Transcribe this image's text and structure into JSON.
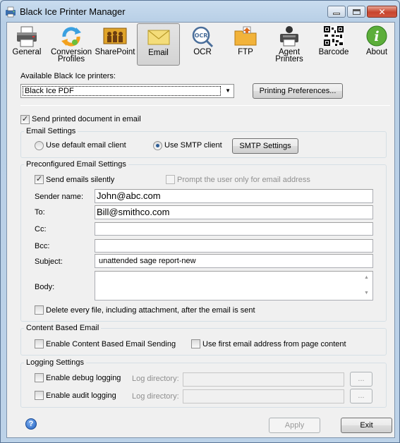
{
  "window": {
    "title": "Black Ice Printer Manager"
  },
  "toolbar": {
    "items": [
      {
        "label": "General",
        "label2": "",
        "icon": "printer-icon",
        "selected": false
      },
      {
        "label": "Conversion",
        "label2": "Profiles",
        "icon": "conversion-arrows-icon",
        "selected": false
      },
      {
        "label": "SharePoint",
        "label2": "",
        "icon": "sharepoint-people-icon",
        "selected": false
      },
      {
        "label": "Email",
        "label2": "",
        "icon": "envelope-icon",
        "selected": true
      },
      {
        "label": "OCR",
        "label2": "",
        "icon": "ocr-icon",
        "selected": false
      },
      {
        "label": "FTP",
        "label2": "",
        "icon": "ftp-folder-icon",
        "selected": false
      },
      {
        "label": "Agent",
        "label2": "Printers",
        "icon": "agent-printer-icon",
        "selected": false
      },
      {
        "label": "Barcode",
        "label2": "",
        "icon": "qr-code-icon",
        "selected": false
      },
      {
        "label": "About",
        "label2": "",
        "icon": "info-icon",
        "selected": false
      }
    ]
  },
  "printers": {
    "label": "Available Black Ice printers:",
    "selected": "Black Ice PDF",
    "preferences_button": "Printing Preferences..."
  },
  "send_email": {
    "label": "Send printed document in email",
    "checked": true
  },
  "email_settings": {
    "title": "Email Settings",
    "default_client_label": "Use default email client",
    "smtp_client_label": "Use SMTP client",
    "selected": "smtp",
    "smtp_button": "SMTP Settings"
  },
  "preconfigured": {
    "title": "Preconfigured Email Settings",
    "send_silently_label": "Send emails silently",
    "send_silently_checked": true,
    "prompt_label": "Prompt the user only for email address",
    "prompt_checked": false,
    "sender_label": "Sender name:",
    "sender_value": "John@abc.com",
    "to_label": "To:",
    "to_value": "Bill@smithco.com",
    "cc_label": "Cc:",
    "cc_value": "",
    "bcc_label": "Bcc:",
    "bcc_value": "",
    "subject_label": "Subject:",
    "subject_value": "unattended sage report-new",
    "body_label": "Body:",
    "body_value": "",
    "delete_label": "Delete every file, including attachment, after the email is sent",
    "delete_checked": false
  },
  "content_based": {
    "title": "Content Based Email",
    "enable_label": "Enable Content Based Email Sending",
    "enable_checked": false,
    "first_address_label": "Use first email address from page content",
    "first_address_checked": false
  },
  "logging": {
    "title": "Logging Settings",
    "debug_label": "Enable debug logging",
    "audit_label": "Enable audit logging",
    "log_dir_label": "Log directory:",
    "browse_label": "...",
    "debug_checked": false,
    "audit_checked": false
  },
  "footer": {
    "apply_label": "Apply",
    "exit_label": "Exit",
    "help_glyph": "?"
  },
  "colors": {
    "accent": "#2d5d96",
    "window_frame": "#bcd2e8",
    "close_red": "#c7452e"
  }
}
